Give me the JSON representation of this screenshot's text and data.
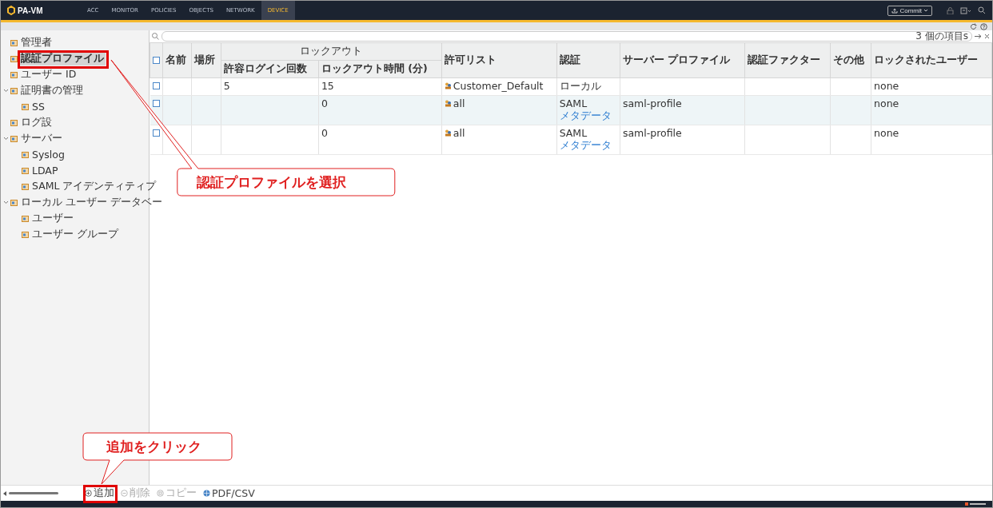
{
  "header": {
    "logo": "PA-VM",
    "tabs": [
      {
        "label": "ACC",
        "selected": false
      },
      {
        "label": "MONITOR",
        "selected": false
      },
      {
        "label": "POLICIES",
        "selected": false
      },
      {
        "label": "OBJECTS",
        "selected": false
      },
      {
        "label": "NETWORK",
        "selected": false
      },
      {
        "label": "DEVICE",
        "selected": true
      }
    ],
    "commit": "Commit"
  },
  "sidebar": {
    "items": [
      {
        "label": "管理者",
        "selected": false
      },
      {
        "label": "認証プロファイル",
        "selected": true
      },
      {
        "label": "ユーザー ID",
        "selected": false
      },
      {
        "label": "証明書の管理",
        "selected": false,
        "expanded": true,
        "children": [
          {
            "label": "SS",
            "selected": false
          }
        ]
      },
      {
        "label": "ログ設",
        "selected": false
      },
      {
        "label": "サーバー",
        "selected": false,
        "expanded": true,
        "children": [
          {
            "label": "Syslog",
            "selected": false
          },
          {
            "label": "LDAP",
            "selected": false
          },
          {
            "label": "SAML アイデンティティプ",
            "selected": false
          }
        ]
      },
      {
        "label": "ローカル ユーザー データベー",
        "selected": false,
        "expanded": true,
        "children": [
          {
            "label": "ユーザー",
            "selected": false
          },
          {
            "label": "ユーザー グループ",
            "selected": false
          }
        ]
      }
    ]
  },
  "search": {
    "count": "3 個の項目s"
  },
  "table": {
    "all_checked": false,
    "group_header": "ロックアウト",
    "columns": [
      "名前",
      "場所",
      "許容ログイン回数",
      "ロックアウト時間 (分)",
      "許可リスト",
      "認証",
      "サーバー プロファイル",
      "認証ファクター",
      "その他",
      "ロックされたユーザー"
    ],
    "rows": [
      {
        "checked": false,
        "cells": [
          "",
          "",
          "5",
          "15",
          "Customer_Default",
          "ローカル",
          "",
          "",
          "",
          "none"
        ]
      },
      {
        "checked": false,
        "cells": [
          "",
          "",
          "",
          "0",
          "all",
          "SAML",
          "saml-profile",
          "",
          "",
          "none"
        ],
        "link": "メタデータ"
      },
      {
        "checked": false,
        "cells": [
          "",
          "",
          "",
          "0",
          "all",
          "SAML",
          "saml-profile",
          "",
          "",
          "none"
        ],
        "link": "メタデータ"
      }
    ]
  },
  "toolbar": [
    {
      "label": "追加",
      "disabled": false
    },
    {
      "label": "削除",
      "disabled": true
    },
    {
      "label": "コピー",
      "disabled": true
    },
    {
      "label": "PDF/CSV",
      "disabled": false
    }
  ],
  "annotations": [
    {
      "text": "認証プロファイルを選択"
    },
    {
      "text": "追加をクリック"
    }
  ]
}
